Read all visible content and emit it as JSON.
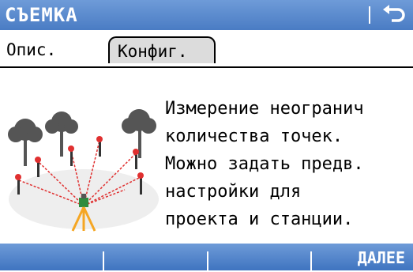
{
  "title": "СЪЕМКА",
  "tabs": [
    {
      "label": "Опис.",
      "active": true
    },
    {
      "label": "Конфиг.",
      "active": false
    }
  ],
  "description": [
    "Измерение неогранич",
    "количества точек.",
    "Можно задать предв.",
    "настройки для",
    "проекта и станции."
  ],
  "softkeys": [
    "",
    "",
    "",
    "ДАЛЕЕ"
  ],
  "colors": {
    "bar_blue": "#4a7cc4",
    "tab_inactive": "#dcdcdc",
    "measure_line": "#e03030",
    "tripod_yellow": "#f5a623"
  },
  "icons": {
    "back": "back-return-icon",
    "illustration": "survey-setup-illustration"
  }
}
